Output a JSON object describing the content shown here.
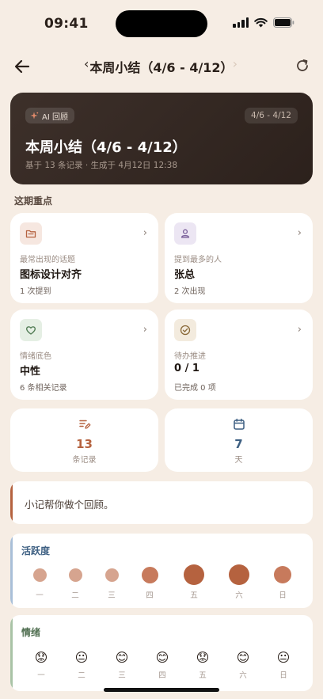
{
  "status_bar": {
    "time": "09:41"
  },
  "nav": {
    "title": "本周小结（4/6 - 4/12）",
    "prev": "‹",
    "next": "›"
  },
  "hero": {
    "badge": "AI 回顾",
    "range": "4/6 - 4/12",
    "title": "本周小结（4/6 - 4/12）",
    "subtitle": "基于 13 条记录 · 生成于 4月12日 12:38"
  },
  "highlights": {
    "section_title": "这期重点",
    "cards": [
      {
        "label": "最常出现的话题",
        "value": "图标设计对齐",
        "meta": "1 次提到",
        "icon": "folder-icon",
        "accent": "#b5623f",
        "bg": "#f6e7e0"
      },
      {
        "label": "提到最多的人",
        "value": "张总",
        "meta": "2 次出现",
        "icon": "person-icon",
        "accent": "#7a5f9a",
        "bg": "#ece6f3"
      },
      {
        "label": "情绪底色",
        "value": "中性",
        "meta": "6 条相关记录",
        "icon": "heart-icon",
        "accent": "#4f7a52",
        "bg": "#e5efe4"
      },
      {
        "label": "待办推进",
        "value": "0 / 1",
        "meta": "已完成 0 项",
        "icon": "check-circle-icon",
        "accent": "#8a6a3a",
        "bg": "#f3ebde"
      }
    ]
  },
  "stats": [
    {
      "value": "13",
      "label": "条记录",
      "icon": "note-edit-icon",
      "color": "#b5623f"
    },
    {
      "value": "7",
      "label": "天",
      "icon": "calendar-icon",
      "color": "#3d5f82"
    }
  ],
  "recap": {
    "text": "小记帮你做个回顾。"
  },
  "activity": {
    "title": "活跃度",
    "title_color": "#3d5f82",
    "bar_color": "#a9bfd8",
    "days": [
      {
        "label": "一",
        "level": 0.25
      },
      {
        "label": "二",
        "level": 0.25
      },
      {
        "label": "三",
        "level": 0.25
      },
      {
        "label": "四",
        "level": 0.6
      },
      {
        "label": "五",
        "level": 1.0
      },
      {
        "label": "六",
        "level": 1.0
      },
      {
        "label": "日",
        "level": 0.7
      }
    ]
  },
  "mood": {
    "title": "情绪",
    "title_color": "#4f6e50",
    "bar_color": "#a9c3a6",
    "days": [
      {
        "label": "一",
        "emoji": "😟"
      },
      {
        "label": "二",
        "emoji": "😐"
      },
      {
        "label": "三",
        "emoji": "😊"
      },
      {
        "label": "四",
        "emoji": "😊"
      },
      {
        "label": "五",
        "emoji": "😟"
      },
      {
        "label": "六",
        "emoji": "😊"
      },
      {
        "label": "日",
        "emoji": "😐"
      }
    ]
  }
}
